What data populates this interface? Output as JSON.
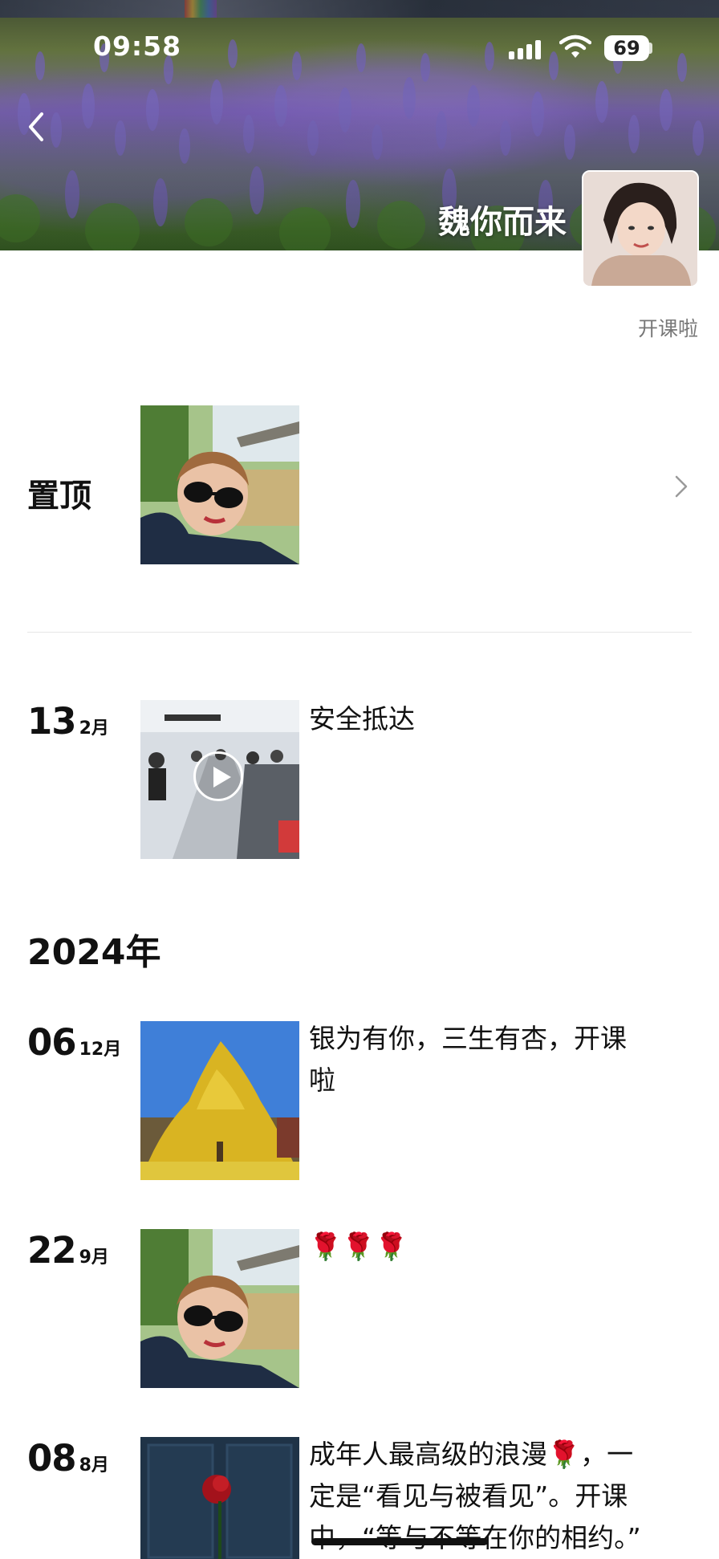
{
  "status_bar": {
    "time": "09:58",
    "battery": "69"
  },
  "profile": {
    "name": "魏你而来",
    "signature": "开课啦"
  },
  "pinned": {
    "label": "置顶"
  },
  "posts_recent": [
    {
      "day": "13",
      "month": "2月",
      "text": "安全抵达",
      "media": "video"
    }
  ],
  "year": "2024年",
  "posts_2024": [
    {
      "day": "06",
      "month": "12月",
      "text_line1": "银为有你，三生有杏，开课",
      "text_line2": "啦"
    },
    {
      "day": "22",
      "month": "9月",
      "text": "🌹🌹🌹"
    },
    {
      "day": "08",
      "month": "8月",
      "text_line1": "成年人最高级的浪漫🌹，一",
      "text_line2": "定是“看见与被看见”。开课",
      "text_line3": "中，“等与不等在你的相约。”"
    }
  ],
  "icons": [
    "back-icon",
    "signal-icon",
    "wifi-icon",
    "battery-icon",
    "chevron-right-icon",
    "play-icon",
    "rose-icon"
  ]
}
